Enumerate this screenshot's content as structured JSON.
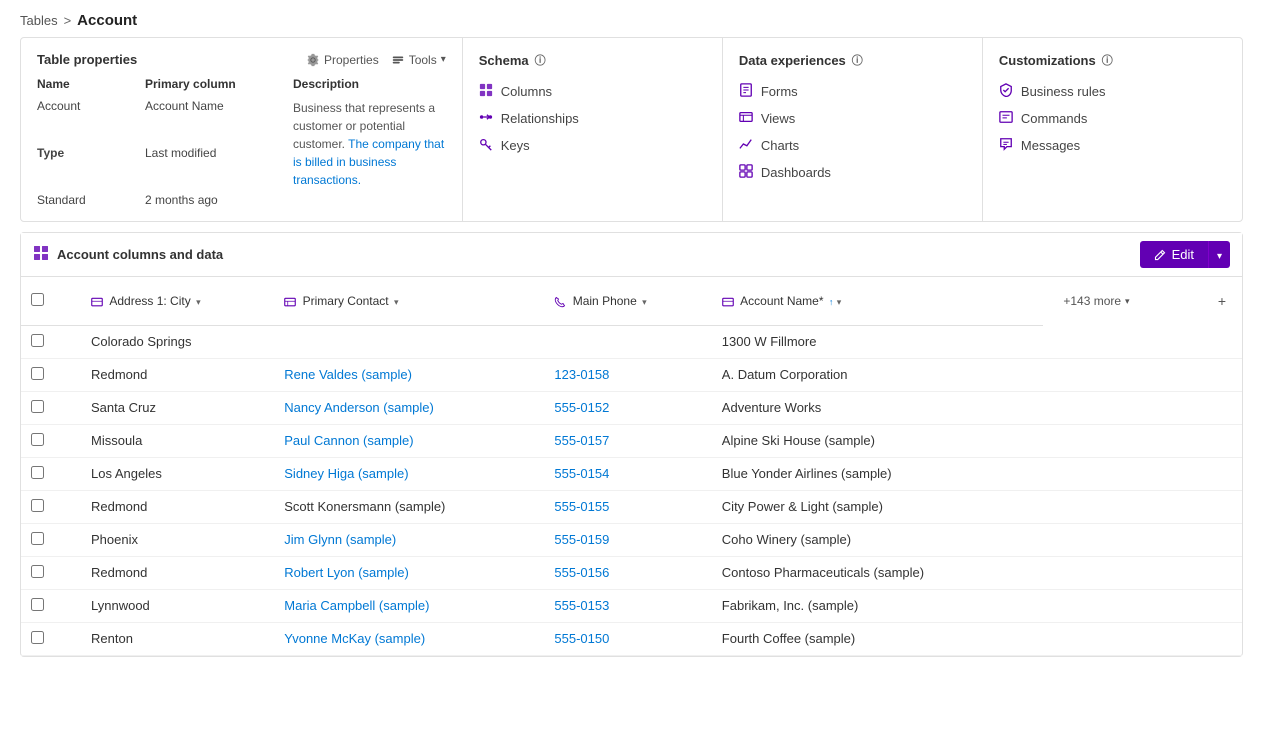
{
  "breadcrumb": {
    "parent": "Tables",
    "separator": ">",
    "current": "Account"
  },
  "tableProperties": {
    "title": "Table properties",
    "tools": {
      "properties": "Properties",
      "tools": "Tools"
    },
    "columns": {
      "name": "Name",
      "primaryColumn": "Primary column",
      "description": "Description"
    },
    "values": {
      "name": "Account",
      "primaryColumn": "Account Name",
      "type_label": "Type",
      "type_value": "Standard",
      "lastModified_label": "Last modified",
      "lastModified_value": "2 months ago",
      "description_plain": "Business that represents a customer or potential customer. ",
      "description_link": "The company that is billed in business transactions."
    }
  },
  "schema": {
    "title": "Schema",
    "items": [
      {
        "id": "columns",
        "label": "Columns",
        "icon": "grid"
      },
      {
        "id": "relationships",
        "label": "Relationships",
        "icon": "relationships"
      },
      {
        "id": "keys",
        "label": "Keys",
        "icon": "keys"
      }
    ]
  },
  "dataExperiences": {
    "title": "Data experiences",
    "items": [
      {
        "id": "forms",
        "label": "Forms",
        "icon": "forms"
      },
      {
        "id": "views",
        "label": "Views",
        "icon": "views"
      },
      {
        "id": "charts",
        "label": "Charts",
        "icon": "charts"
      },
      {
        "id": "dashboards",
        "label": "Dashboards",
        "icon": "dashboards"
      }
    ]
  },
  "customizations": {
    "title": "Customizations",
    "items": [
      {
        "id": "business-rules",
        "label": "Business rules",
        "icon": "business-rules"
      },
      {
        "id": "commands",
        "label": "Commands",
        "icon": "commands"
      },
      {
        "id": "messages",
        "label": "Messages",
        "icon": "messages"
      }
    ]
  },
  "dataSection": {
    "title": "Account columns and data",
    "editLabel": "Edit",
    "columns": [
      {
        "id": "address1city",
        "label": "Address 1: City",
        "icon": "text",
        "sortable": true
      },
      {
        "id": "primarycontact",
        "label": "Primary Contact",
        "icon": "lookup",
        "sortable": false
      },
      {
        "id": "mainphone",
        "label": "Main Phone",
        "icon": "phone",
        "sortable": true
      },
      {
        "id": "accountname",
        "label": "Account Name*",
        "icon": "text",
        "sortable": true,
        "required": true
      }
    ],
    "moreColumns": "+143 more",
    "rows": [
      {
        "city": "Colorado Springs",
        "primaryContact": "",
        "mainPhone": "",
        "accountName": "1300 W Fillmore",
        "contactLink": false,
        "phoneLink": false
      },
      {
        "city": "Redmond",
        "primaryContact": "Rene Valdes (sample)",
        "mainPhone": "123-0158",
        "accountName": "A. Datum Corporation",
        "contactLink": true,
        "phoneLink": true
      },
      {
        "city": "Santa Cruz",
        "primaryContact": "Nancy Anderson (sample)",
        "mainPhone": "555-0152",
        "accountName": "Adventure Works",
        "contactLink": true,
        "phoneLink": true
      },
      {
        "city": "Missoula",
        "primaryContact": "Paul Cannon (sample)",
        "mainPhone": "555-0157",
        "accountName": "Alpine Ski House (sample)",
        "contactLink": true,
        "phoneLink": true
      },
      {
        "city": "Los Angeles",
        "primaryContact": "Sidney Higa (sample)",
        "mainPhone": "555-0154",
        "accountName": "Blue Yonder Airlines (sample)",
        "contactLink": true,
        "phoneLink": true
      },
      {
        "city": "Redmond",
        "primaryContact": "Scott Konersmann (sample)",
        "mainPhone": "555-0155",
        "accountName": "City Power & Light (sample)",
        "contactLink": false,
        "phoneLink": true
      },
      {
        "city": "Phoenix",
        "primaryContact": "Jim Glynn (sample)",
        "mainPhone": "555-0159",
        "accountName": "Coho Winery (sample)",
        "contactLink": true,
        "phoneLink": true
      },
      {
        "city": "Redmond",
        "primaryContact": "Robert Lyon (sample)",
        "mainPhone": "555-0156",
        "accountName": "Contoso Pharmaceuticals (sample)",
        "contactLink": true,
        "phoneLink": true
      },
      {
        "city": "Lynnwood",
        "primaryContact": "Maria Campbell (sample)",
        "mainPhone": "555-0153",
        "accountName": "Fabrikam, Inc. (sample)",
        "contactLink": true,
        "phoneLink": true
      },
      {
        "city": "Renton",
        "primaryContact": "Yvonne McKay (sample)",
        "mainPhone": "555-0150",
        "accountName": "Fourth Coffee (sample)",
        "contactLink": true,
        "phoneLink": true
      }
    ]
  }
}
